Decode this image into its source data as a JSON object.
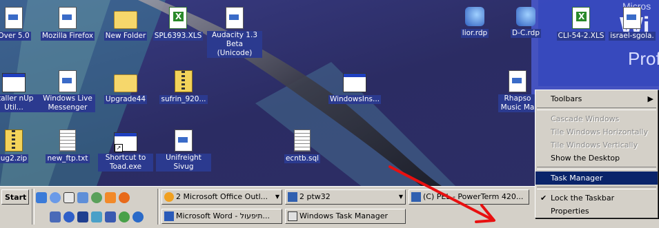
{
  "desktop": {
    "icons": [
      {
        "label": "Over 5.0",
        "type": "doc"
      },
      {
        "label": "Mozilla Firefox",
        "type": "doc"
      },
      {
        "label": "New Folder",
        "type": "folder"
      },
      {
        "label": "SPL6393.XLS",
        "type": "xls"
      },
      {
        "label": "Audacity 1.3 Beta (Unicode)",
        "type": "doc"
      },
      {
        "label": "lior.rdp",
        "type": "rdp"
      },
      {
        "label": "D-C.rdp",
        "type": "rdp"
      },
      {
        "label": "CLI-54-2.XLS",
        "type": "xls"
      },
      {
        "label": "israel-sgola.",
        "type": "doc"
      },
      {
        "label": "staller nUp Util...",
        "type": "win"
      },
      {
        "label": "Windows Live Messenger",
        "type": "doc"
      },
      {
        "label": "Upgrade44",
        "type": "folder"
      },
      {
        "label": "sufrin_920...",
        "type": "zip"
      },
      {
        "label": "WindowsIns...",
        "type": "win"
      },
      {
        "label": "Rhapso Music Ma",
        "type": "doc"
      },
      {
        "label": "ug2.zip",
        "type": "zip"
      },
      {
        "label": "new_ftp.txt",
        "type": "txt"
      },
      {
        "label": "Shortcut to Toad.exe",
        "type": "win"
      },
      {
        "label": "Unifreight Sivug",
        "type": "doc"
      },
      {
        "label": "ecntb.sql",
        "type": "txt"
      }
    ],
    "wallpaper_text": [
      "Micros",
      "Wi",
      "Prof"
    ]
  },
  "context_menu": {
    "items": [
      {
        "label": "Toolbars",
        "state": "normal",
        "submenu": true
      },
      {
        "label": "Cascade Windows",
        "state": "disabled"
      },
      {
        "label": "Tile Windows Horizontally",
        "state": "disabled"
      },
      {
        "label": "Tile Windows Vertically",
        "state": "disabled"
      },
      {
        "label": "Show the Desktop",
        "state": "normal"
      },
      {
        "label": "Task Manager",
        "state": "selected"
      },
      {
        "label": "Lock the Taskbar",
        "state": "normal",
        "checked": true
      },
      {
        "label": "Properties",
        "state": "normal"
      }
    ]
  },
  "taskbar": {
    "start_label": "Start",
    "buttons": [
      {
        "label": "2 Microsoft Office Outl...",
        "bold_prefix": "2"
      },
      {
        "label": "2 ptw32",
        "bold_prefix": "2"
      },
      {
        "label": "(C) PEL - PowerTerm 420...",
        "bold_prefix": ""
      },
      {
        "label": "Microsoft Word - תיפעול...",
        "bold_prefix": ""
      },
      {
        "label": "Windows Task Manager",
        "bold_prefix": ""
      }
    ]
  },
  "colors": {
    "desktop": "#2e2f6b",
    "taskbar": "#d4d0c8",
    "menu_highlight": "#0a246a",
    "annotation_arrow": "#e81010"
  }
}
